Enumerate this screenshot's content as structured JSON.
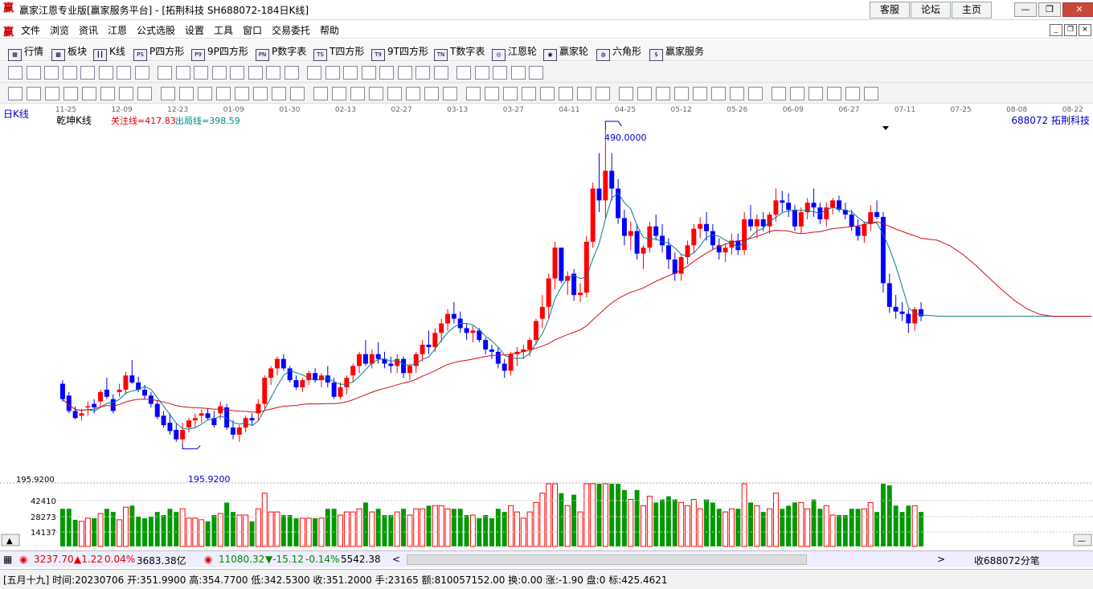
{
  "window": {
    "title": "赢家江恩专业版[赢家服务平台] - [拓荆科技  SH688072-184日K线]",
    "logo_char": "赢",
    "links": [
      "客服",
      "论坛",
      "主页"
    ],
    "controls": [
      "—",
      "❐",
      "✕"
    ]
  },
  "menu": {
    "items": [
      "文件",
      "浏览",
      "资讯",
      "江恩",
      "公式选股",
      "设置",
      "工具",
      "窗口",
      "交易委托",
      "帮助"
    ],
    "mdi_controls": [
      "_",
      "❐",
      "×"
    ]
  },
  "nav": {
    "items": [
      {
        "icon": "▦",
        "label": "行情"
      },
      {
        "icon": "▩",
        "label": "板块"
      },
      {
        "icon": "┃┃",
        "label": "K线"
      },
      {
        "icon": "PS",
        "label": "P四方形"
      },
      {
        "icon": "P9",
        "label": "9P四方形"
      },
      {
        "icon": "PN",
        "label": "P数字表"
      },
      {
        "icon": "TS",
        "label": "T四方形"
      },
      {
        "icon": "T9",
        "label": "9T四方形"
      },
      {
        "icon": "TN",
        "label": "T数字表"
      },
      {
        "icon": "◎",
        "label": "江恩轮"
      },
      {
        "icon": "◉",
        "label": "赢家轮"
      },
      {
        "icon": "◍",
        "label": "六角形"
      },
      {
        "icon": "$",
        "label": "赢家服务"
      }
    ]
  },
  "chart": {
    "period_label": "日K线",
    "indicator_name": "乾坤K线",
    "focus_line": "关注线=417.83",
    "exit_line": "出局线=398.59",
    "stock_label": "688072  拓荆科技",
    "high_label": "490.0000",
    "low_label": "195.9200",
    "price_axis_label": "195.9200",
    "volume_ticks": [
      "42410",
      "28273",
      "14137"
    ],
    "date_ticks": [
      "11-25",
      "12-09",
      "12-23",
      "01-09",
      "01-30",
      "02-13",
      "02-27",
      "03-13",
      "03-27",
      "04-11",
      "04-25",
      "05-12",
      "05-26",
      "06-09",
      "06-27",
      "07-11",
      "07-25",
      "08-08",
      "08-22"
    ],
    "colors": {
      "up": "#ff0000",
      "down": "#0000ff",
      "neutral": "#800080",
      "ma_short": "#0a7a8c",
      "ma_long": "#d01010",
      "volume_up": "#ff0000",
      "volume_down": "#009900"
    }
  },
  "chart_data": {
    "type": "candlestick",
    "title": "拓荆科技 SH688072 日K线",
    "ylim": [
      195.92,
      490.0
    ],
    "series": [
      {
        "name": "K",
        "values": [
          [
            275,
            278,
            260,
            262
          ],
          [
            265,
            268,
            250,
            252
          ],
          [
            252,
            256,
            245,
            246
          ],
          [
            248,
            254,
            244,
            250
          ],
          [
            255,
            260,
            248,
            256
          ],
          [
            258,
            262,
            250,
            255
          ],
          [
            260,
            270,
            255,
            268
          ],
          [
            270,
            280,
            262,
            264
          ],
          [
            262,
            266,
            250,
            252
          ],
          [
            268,
            275,
            264,
            270
          ],
          [
            270,
            285,
            266,
            282
          ],
          [
            282,
            295,
            275,
            276
          ],
          [
            276,
            281,
            268,
            270
          ],
          [
            270,
            274,
            262,
            265
          ],
          [
            265,
            268,
            255,
            258
          ],
          [
            258,
            261,
            245,
            247
          ],
          [
            248,
            252,
            238,
            240
          ],
          [
            242,
            250,
            232,
            235
          ],
          [
            236,
            242,
            226,
            228
          ],
          [
            228,
            242,
            224,
            236
          ],
          [
            238,
            246,
            234,
            244
          ],
          [
            244,
            250,
            238,
            246
          ],
          [
            248,
            253,
            242,
            250
          ],
          [
            250,
            254,
            244,
            246
          ],
          [
            246,
            252,
            238,
            240
          ],
          [
            250,
            260,
            245,
            256
          ],
          [
            255,
            258,
            236,
            238
          ],
          [
            238,
            244,
            228,
            232
          ],
          [
            232,
            240,
            226,
            238
          ],
          [
            238,
            248,
            234,
            246
          ],
          [
            246,
            250,
            240,
            244
          ],
          [
            250,
            262,
            244,
            258
          ],
          [
            258,
            282,
            254,
            280
          ],
          [
            280,
            290,
            274,
            288
          ],
          [
            288,
            298,
            282,
            296
          ],
          [
            296,
            300,
            286,
            288
          ],
          [
            288,
            290,
            276,
            278
          ],
          [
            278,
            282,
            270,
            272
          ],
          [
            272,
            280,
            268,
            278
          ],
          [
            278,
            286,
            274,
            284
          ],
          [
            284,
            288,
            276,
            278
          ],
          [
            278,
            284,
            272,
            282
          ],
          [
            282,
            290,
            272,
            276
          ],
          [
            276,
            280,
            262,
            264
          ],
          [
            264,
            276,
            262,
            272
          ],
          [
            272,
            282,
            266,
            280
          ],
          [
            282,
            292,
            276,
            290
          ],
          [
            290,
            302,
            284,
            300
          ],
          [
            300,
            312,
            290,
            292
          ],
          [
            292,
            304,
            288,
            300
          ],
          [
            300,
            310,
            292,
            296
          ],
          [
            296,
            302,
            288,
            292
          ],
          [
            292,
            298,
            284,
            290
          ],
          [
            290,
            300,
            284,
            296
          ],
          [
            296,
            298,
            280,
            284
          ],
          [
            284,
            292,
            278,
            290
          ],
          [
            290,
            302,
            284,
            300
          ],
          [
            300,
            312,
            294,
            308
          ],
          [
            308,
            320,
            300,
            306
          ],
          [
            306,
            322,
            302,
            318
          ],
          [
            318,
            330,
            310,
            326
          ],
          [
            326,
            338,
            320,
            334
          ],
          [
            334,
            344,
            326,
            330
          ],
          [
            330,
            336,
            318,
            322
          ],
          [
            322,
            326,
            312,
            318
          ],
          [
            318,
            324,
            310,
            320
          ],
          [
            320,
            322,
            310,
            312
          ],
          [
            312,
            314,
            300,
            304
          ],
          [
            304,
            308,
            296,
            302
          ],
          [
            302,
            306,
            288,
            292
          ],
          [
            292,
            296,
            280,
            286
          ],
          [
            286,
            302,
            282,
            300
          ],
          [
            300,
            306,
            290,
            302
          ],
          [
            302,
            308,
            296,
            304
          ],
          [
            304,
            314,
            298,
            312
          ],
          [
            312,
            330,
            308,
            328
          ],
          [
            330,
            350,
            322,
            340
          ],
          [
            340,
            368,
            330,
            364
          ],
          [
            364,
            395,
            355,
            390
          ],
          [
            390,
            388,
            360,
            362
          ],
          [
            362,
            370,
            350,
            366
          ],
          [
            368,
            372,
            345,
            350
          ],
          [
            350,
            360,
            344,
            352
          ],
          [
            352,
            400,
            348,
            395
          ],
          [
            395,
            445,
            390,
            440
          ],
          [
            440,
            470,
            420,
            430
          ],
          [
            430,
            490,
            415,
            455
          ],
          [
            455,
            470,
            430,
            440
          ],
          [
            440,
            448,
            410,
            415
          ],
          [
            415,
            422,
            392,
            400
          ],
          [
            400,
            412,
            388,
            404
          ],
          [
            404,
            410,
            380,
            385
          ],
          [
            385,
            392,
            372,
            390
          ],
          [
            390,
            412,
            386,
            408
          ],
          [
            408,
            418,
            396,
            400
          ],
          [
            400,
            410,
            386,
            392
          ],
          [
            392,
            398,
            372,
            380
          ],
          [
            380,
            386,
            362,
            368
          ],
          [
            368,
            384,
            362,
            382
          ],
          [
            382,
            396,
            376,
            392
          ],
          [
            392,
            410,
            386,
            406
          ],
          [
            406,
            416,
            398,
            410
          ],
          [
            410,
            420,
            396,
            404
          ],
          [
            404,
            410,
            388,
            392
          ],
          [
            392,
            398,
            380,
            386
          ],
          [
            386,
            394,
            378,
            390
          ],
          [
            390,
            402,
            384,
            396
          ],
          [
            396,
            402,
            384,
            388
          ],
          [
            388,
            420,
            384,
            414
          ],
          [
            414,
            426,
            404,
            408
          ],
          [
            408,
            418,
            398,
            414
          ],
          [
            414,
            420,
            404,
            408
          ],
          [
            408,
            420,
            402,
            418
          ],
          [
            418,
            440,
            412,
            430
          ],
          [
            430,
            438,
            420,
            428
          ],
          [
            428,
            436,
            416,
            422
          ],
          [
            422,
            426,
            404,
            408
          ],
          [
            408,
            424,
            402,
            420
          ],
          [
            420,
            432,
            414,
            428
          ],
          [
            428,
            440,
            416,
            424
          ],
          [
            424,
            428,
            410,
            414
          ],
          [
            414,
            428,
            408,
            424
          ],
          [
            424,
            432,
            418,
            430
          ],
          [
            430,
            434,
            420,
            422
          ],
          [
            422,
            428,
            414,
            418
          ],
          [
            418,
            422,
            404,
            408
          ],
          [
            408,
            414,
            396,
            400
          ],
          [
            400,
            412,
            394,
            410
          ],
          [
            410,
            426,
            404,
            420
          ],
          [
            420,
            430,
            414,
            416
          ],
          [
            416,
            420,
            352,
            360
          ],
          [
            360,
            368,
            335,
            340
          ],
          [
            340,
            350,
            330,
            336
          ],
          [
            336,
            344,
            328,
            334
          ],
          [
            334,
            338,
            318,
            326
          ],
          [
            326,
            340,
            320,
            338
          ],
          [
            338,
            344,
            328,
            332
          ]
        ]
      }
    ],
    "ma_short_note": "short moving average",
    "ma_long_note": "long moving average"
  }
}
